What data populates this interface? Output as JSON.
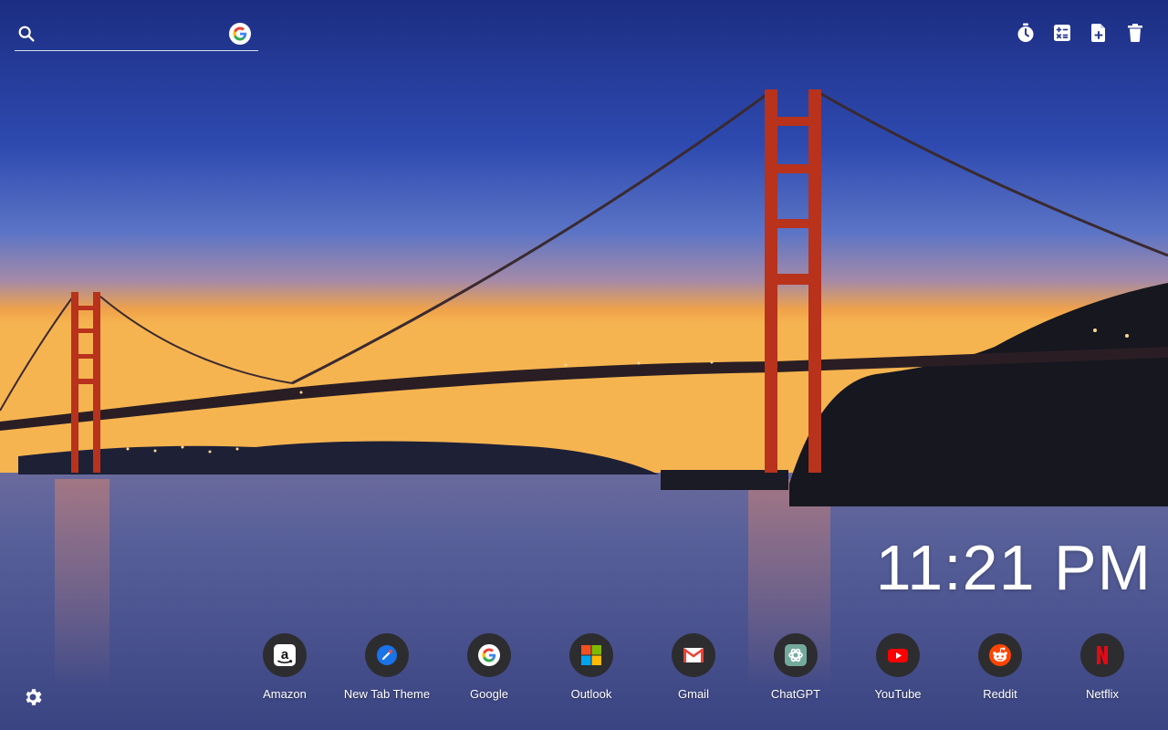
{
  "search": {
    "value": "",
    "placeholder": "",
    "engine_icon": "google-icon"
  },
  "toolbar": {
    "items": [
      {
        "icon": "timer-icon"
      },
      {
        "icon": "calculator-icon"
      },
      {
        "icon": "add-note-icon"
      },
      {
        "icon": "trash-icon"
      }
    ]
  },
  "clock": {
    "time": "11:21 PM"
  },
  "shortcuts": [
    {
      "label": "Amazon",
      "icon": "amazon-icon"
    },
    {
      "label": "New Tab Theme",
      "icon": "new-tab-theme-icon"
    },
    {
      "label": "Google",
      "icon": "google-icon"
    },
    {
      "label": "Outlook",
      "icon": "microsoft-icon"
    },
    {
      "label": "Gmail",
      "icon": "gmail-icon"
    },
    {
      "label": "ChatGPT",
      "icon": "chatgpt-icon"
    },
    {
      "label": "YouTube",
      "icon": "youtube-icon"
    },
    {
      "label": "Reddit",
      "icon": "reddit-icon"
    },
    {
      "label": "Netflix",
      "icon": "netflix-icon"
    }
  ],
  "settings": {
    "icon": "gear-icon"
  },
  "colors": {
    "sky_top": "#1e2f86",
    "sky_mid": "#5a72c8",
    "horizon": "#f0a040",
    "bridge": "#c8361c",
    "water": "#4a4f88",
    "dock_circle": "#2d2d30"
  }
}
